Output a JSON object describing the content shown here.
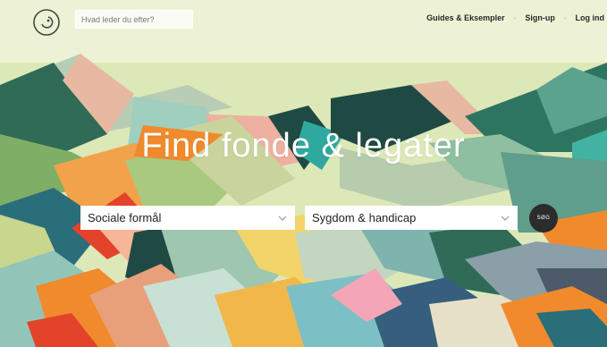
{
  "header": {
    "search_placeholder": "Hvad leder du efter?",
    "nav": [
      {
        "label": "Guides & Eksempler"
      },
      {
        "label": "Sign-up"
      },
      {
        "label": "Log ind"
      }
    ]
  },
  "hero": {
    "title": "Find fonde & legater",
    "filters": [
      {
        "selected": "Sociale formål"
      },
      {
        "selected": "Sygdom & handicap"
      }
    ],
    "search_button_label": "SØG"
  },
  "colors": {
    "sky": "#dde8b8",
    "dark_green": "#1f4a43",
    "orange": "#f08a2c",
    "button": "#2b2c2c"
  }
}
